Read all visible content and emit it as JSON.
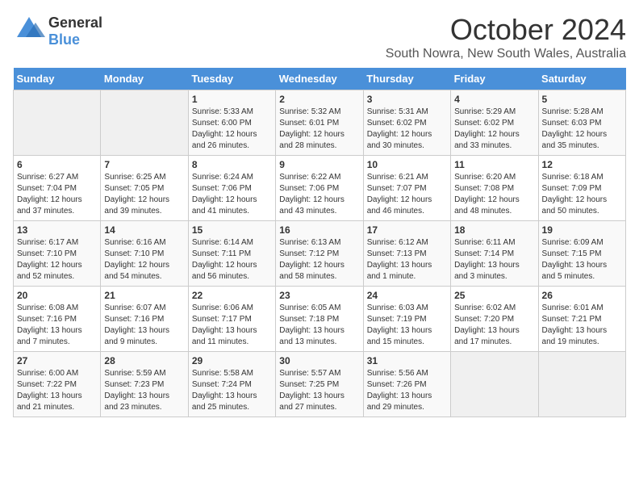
{
  "header": {
    "logo_general": "General",
    "logo_blue": "Blue",
    "month": "October 2024",
    "location": "South Nowra, New South Wales, Australia"
  },
  "days_of_week": [
    "Sunday",
    "Monday",
    "Tuesday",
    "Wednesday",
    "Thursday",
    "Friday",
    "Saturday"
  ],
  "weeks": [
    [
      {
        "day": "",
        "info": ""
      },
      {
        "day": "",
        "info": ""
      },
      {
        "day": "1",
        "info": "Sunrise: 5:33 AM\nSunset: 6:00 PM\nDaylight: 12 hours\nand 26 minutes."
      },
      {
        "day": "2",
        "info": "Sunrise: 5:32 AM\nSunset: 6:01 PM\nDaylight: 12 hours\nand 28 minutes."
      },
      {
        "day": "3",
        "info": "Sunrise: 5:31 AM\nSunset: 6:02 PM\nDaylight: 12 hours\nand 30 minutes."
      },
      {
        "day": "4",
        "info": "Sunrise: 5:29 AM\nSunset: 6:02 PM\nDaylight: 12 hours\nand 33 minutes."
      },
      {
        "day": "5",
        "info": "Sunrise: 5:28 AM\nSunset: 6:03 PM\nDaylight: 12 hours\nand 35 minutes."
      }
    ],
    [
      {
        "day": "6",
        "info": "Sunrise: 6:27 AM\nSunset: 7:04 PM\nDaylight: 12 hours\nand 37 minutes."
      },
      {
        "day": "7",
        "info": "Sunrise: 6:25 AM\nSunset: 7:05 PM\nDaylight: 12 hours\nand 39 minutes."
      },
      {
        "day": "8",
        "info": "Sunrise: 6:24 AM\nSunset: 7:06 PM\nDaylight: 12 hours\nand 41 minutes."
      },
      {
        "day": "9",
        "info": "Sunrise: 6:22 AM\nSunset: 7:06 PM\nDaylight: 12 hours\nand 43 minutes."
      },
      {
        "day": "10",
        "info": "Sunrise: 6:21 AM\nSunset: 7:07 PM\nDaylight: 12 hours\nand 46 minutes."
      },
      {
        "day": "11",
        "info": "Sunrise: 6:20 AM\nSunset: 7:08 PM\nDaylight: 12 hours\nand 48 minutes."
      },
      {
        "day": "12",
        "info": "Sunrise: 6:18 AM\nSunset: 7:09 PM\nDaylight: 12 hours\nand 50 minutes."
      }
    ],
    [
      {
        "day": "13",
        "info": "Sunrise: 6:17 AM\nSunset: 7:10 PM\nDaylight: 12 hours\nand 52 minutes."
      },
      {
        "day": "14",
        "info": "Sunrise: 6:16 AM\nSunset: 7:10 PM\nDaylight: 12 hours\nand 54 minutes."
      },
      {
        "day": "15",
        "info": "Sunrise: 6:14 AM\nSunset: 7:11 PM\nDaylight: 12 hours\nand 56 minutes."
      },
      {
        "day": "16",
        "info": "Sunrise: 6:13 AM\nSunset: 7:12 PM\nDaylight: 12 hours\nand 58 minutes."
      },
      {
        "day": "17",
        "info": "Sunrise: 6:12 AM\nSunset: 7:13 PM\nDaylight: 13 hours\nand 1 minute."
      },
      {
        "day": "18",
        "info": "Sunrise: 6:11 AM\nSunset: 7:14 PM\nDaylight: 13 hours\nand 3 minutes."
      },
      {
        "day": "19",
        "info": "Sunrise: 6:09 AM\nSunset: 7:15 PM\nDaylight: 13 hours\nand 5 minutes."
      }
    ],
    [
      {
        "day": "20",
        "info": "Sunrise: 6:08 AM\nSunset: 7:16 PM\nDaylight: 13 hours\nand 7 minutes."
      },
      {
        "day": "21",
        "info": "Sunrise: 6:07 AM\nSunset: 7:16 PM\nDaylight: 13 hours\nand 9 minutes."
      },
      {
        "day": "22",
        "info": "Sunrise: 6:06 AM\nSunset: 7:17 PM\nDaylight: 13 hours\nand 11 minutes."
      },
      {
        "day": "23",
        "info": "Sunrise: 6:05 AM\nSunset: 7:18 PM\nDaylight: 13 hours\nand 13 minutes."
      },
      {
        "day": "24",
        "info": "Sunrise: 6:03 AM\nSunset: 7:19 PM\nDaylight: 13 hours\nand 15 minutes."
      },
      {
        "day": "25",
        "info": "Sunrise: 6:02 AM\nSunset: 7:20 PM\nDaylight: 13 hours\nand 17 minutes."
      },
      {
        "day": "26",
        "info": "Sunrise: 6:01 AM\nSunset: 7:21 PM\nDaylight: 13 hours\nand 19 minutes."
      }
    ],
    [
      {
        "day": "27",
        "info": "Sunrise: 6:00 AM\nSunset: 7:22 PM\nDaylight: 13 hours\nand 21 minutes."
      },
      {
        "day": "28",
        "info": "Sunrise: 5:59 AM\nSunset: 7:23 PM\nDaylight: 13 hours\nand 23 minutes."
      },
      {
        "day": "29",
        "info": "Sunrise: 5:58 AM\nSunset: 7:24 PM\nDaylight: 13 hours\nand 25 minutes."
      },
      {
        "day": "30",
        "info": "Sunrise: 5:57 AM\nSunset: 7:25 PM\nDaylight: 13 hours\nand 27 minutes."
      },
      {
        "day": "31",
        "info": "Sunrise: 5:56 AM\nSunset: 7:26 PM\nDaylight: 13 hours\nand 29 minutes."
      },
      {
        "day": "",
        "info": ""
      },
      {
        "day": "",
        "info": ""
      }
    ]
  ]
}
